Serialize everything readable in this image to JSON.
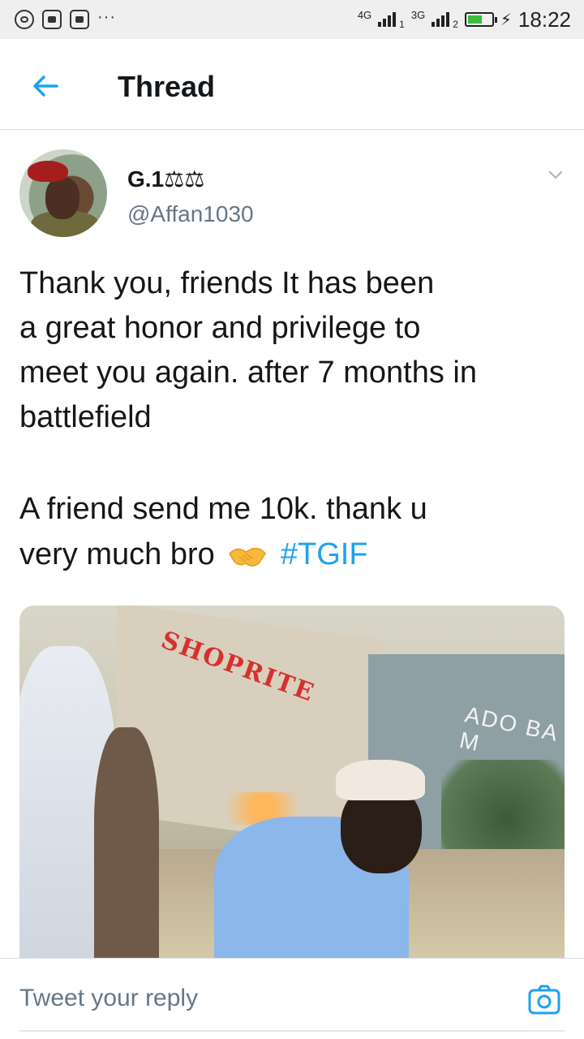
{
  "status_bar": {
    "network_1": "4G",
    "sim_1": "1",
    "network_2": "3G",
    "sim_2": "2",
    "battery_level": 0.6,
    "time": "18:22",
    "notification_icons": [
      "whatsapp-icon",
      "app-icon",
      "app-icon"
    ],
    "more": "···"
  },
  "header": {
    "title": "Thread"
  },
  "tweet": {
    "name": "G.1⚖⚖",
    "handle": "@Affan1030",
    "text_lines": [
      "Thank you, friends It has been",
      "a great honor and privilege to",
      "meet you again. after 7 months in",
      "battlefield",
      "A friend  send me 10k. thank u",
      "very much bro"
    ],
    "emoji": "handshake",
    "hashtag": "#TGIF",
    "media_sign_1": "SHOPRITE",
    "media_sign_2": "ADO BA\nM"
  },
  "reply": {
    "placeholder": "Tweet your reply"
  },
  "colors": {
    "accent": "#1da1f2",
    "text": "#14171a",
    "muted": "#657786",
    "divider": "#d8dde1"
  }
}
